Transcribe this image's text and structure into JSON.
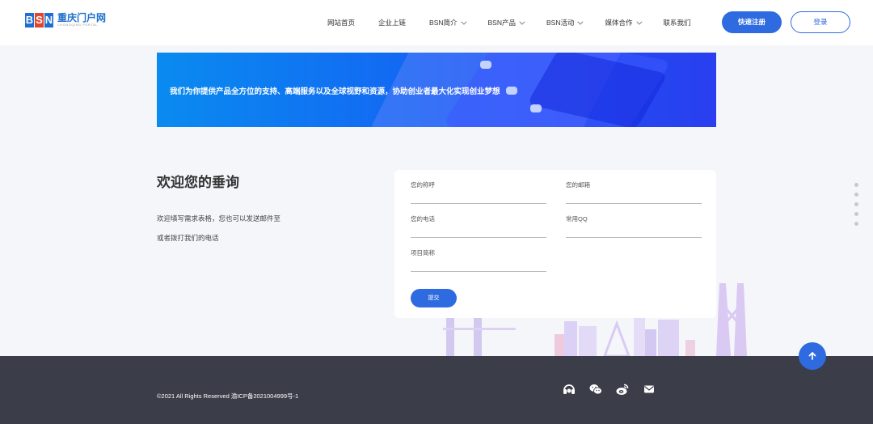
{
  "logo": {
    "letters": [
      "B",
      "S",
      "N"
    ],
    "name": "重庆门户网",
    "tagline": "CHONGQING PORTAL"
  },
  "nav": {
    "items": [
      {
        "label": "网站首页",
        "dropdown": false
      },
      {
        "label": "企业上链",
        "dropdown": false
      },
      {
        "label": "BSN简介",
        "dropdown": true
      },
      {
        "label": "BSN产品",
        "dropdown": true
      },
      {
        "label": "BSN活动",
        "dropdown": true
      },
      {
        "label": "媒体合作",
        "dropdown": true
      },
      {
        "label": "联系我们",
        "dropdown": false
      }
    ],
    "register_label": "快速注册",
    "login_label": "登录"
  },
  "banner": {
    "text": "我们为你提供产品全方位的支持、高端服务以及全球视野和资源，协助创业者最大化实现创业梦想"
  },
  "welcome": {
    "title": "欢迎您的垂询",
    "desc_line1": "欢迎填写需求表格，您也可以发送邮件至",
    "desc_line2": "或者拨打我们的电话"
  },
  "form": {
    "name_label": "您的称呼",
    "email_label": "您的邮箱",
    "phone_label": "您的电话",
    "qq_label": "常用QQ",
    "project_label": "项目简称",
    "submit_label": "提交"
  },
  "footer": {
    "copyright": "©2021 All Rights Reserved 渝ICP备2021004999号-1",
    "social_icons": [
      "headset-icon",
      "wechat-icon",
      "weibo-icon",
      "mail-icon"
    ]
  },
  "colors": {
    "primary": "#2f6be0",
    "footer_bg": "#3b3d49",
    "page_bg": "#f5f6fa"
  }
}
